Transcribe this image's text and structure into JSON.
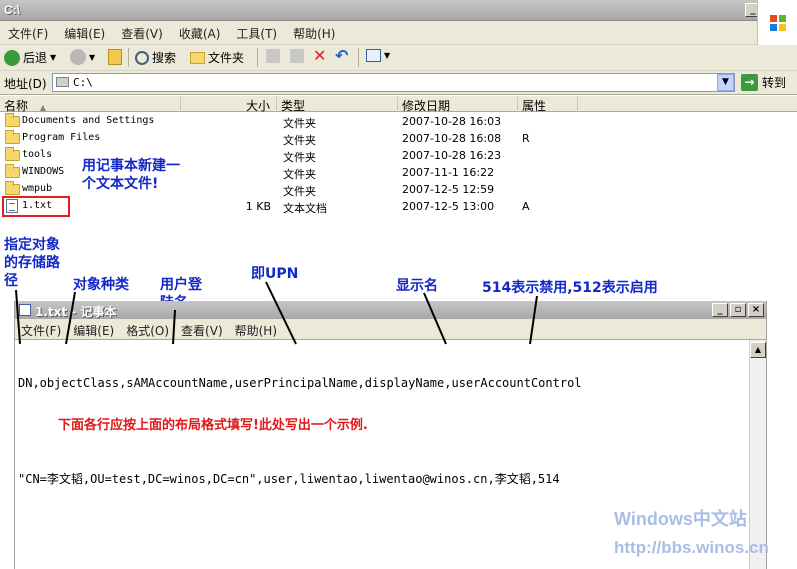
{
  "explorer": {
    "title": "C:\\",
    "menu": [
      "文件(F)",
      "编辑(E)",
      "查看(V)",
      "收藏(A)",
      "工具(T)",
      "帮助(H)"
    ],
    "toolbar": {
      "back": "后退",
      "search": "搜索",
      "folders": "文件夹"
    },
    "address": {
      "label": "地址(D)",
      "value": "C:\\",
      "go": "转到"
    },
    "columns": {
      "name": "名称",
      "size": "大小",
      "type": "类型",
      "modified": "修改日期",
      "attrs": "属性"
    },
    "files": [
      {
        "name": "Documents and Settings",
        "size": "",
        "type": "文件夹",
        "modified": "2007-10-28 16:03",
        "attrs": ""
      },
      {
        "name": "Program Files",
        "size": "",
        "type": "文件夹",
        "modified": "2007-10-28 16:08",
        "attrs": "R"
      },
      {
        "name": "tools",
        "size": "",
        "type": "文件夹",
        "modified": "2007-10-28 16:23",
        "attrs": ""
      },
      {
        "name": "WINDOWS",
        "size": "",
        "type": "文件夹",
        "modified": "2007-11-1 16:22",
        "attrs": ""
      },
      {
        "name": "wmpub",
        "size": "",
        "type": "文件夹",
        "modified": "2007-12-5 12:59",
        "attrs": ""
      },
      {
        "name": "1.txt",
        "size": "1 KB",
        "type": "文本文档",
        "modified": "2007-12-5 13:00",
        "attrs": "A"
      }
    ]
  },
  "annotations": {
    "new_file_line1": "用记事本新建一",
    "new_file_line2": "个文本文件!",
    "dn_line1": "指定对象",
    "dn_line2": "的存储路",
    "dn_line3": "径",
    "object_class": "对象种类",
    "sam_line1": "用户登",
    "sam_line2": "陆名",
    "upn": "即UPN",
    "display_name": "显示名",
    "uac": "514表示禁用,512表示启用",
    "bottom_note": "下面各行应按上面的布局格式填写!此处写出一个示例."
  },
  "notepad": {
    "title": "1.txt - 记事本",
    "menu": [
      "文件(F)",
      "编辑(E)",
      "格式(O)",
      "查看(V)",
      "帮助(H)"
    ],
    "lines": [
      "DN,objectClass,sAMAccountName,userPrincipalName,displayName,userAccountControl",
      "",
      "\"CN=李文韬,OU=test,DC=winos,DC=cn\",user,liwentao,liwentao@winos.cn,李文韬,514"
    ]
  },
  "watermark": {
    "line1": "Windows中文站",
    "line2": "http://bbs.winos.cn"
  }
}
